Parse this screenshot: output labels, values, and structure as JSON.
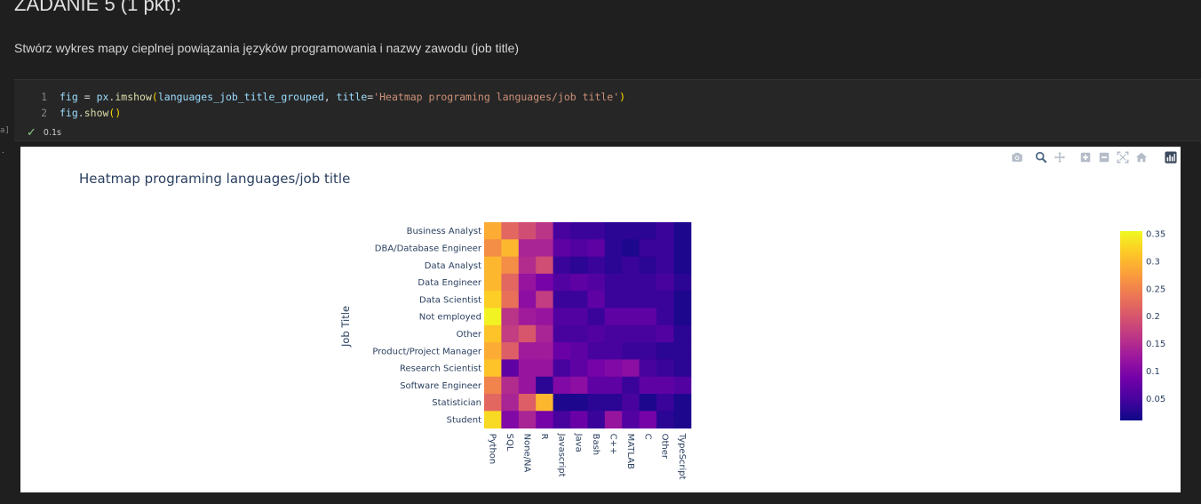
{
  "markdown": {
    "heading": "ZADANIE 5 (1 pkt):",
    "instruction": "Stwórz wykres mapy cieplnej powiązania języków programowania i nazwy zawodu (job title)"
  },
  "cell": {
    "execution_count": "a]",
    "line_numbers": [
      "1",
      "2"
    ],
    "line1": {
      "var": "fig",
      "eq": " = ",
      "mod": "px",
      "dot": ".",
      "fn": "imshow",
      "open": "(",
      "arg": "languages_job_title_grouped",
      "comma": ", ",
      "kw": "title",
      "assign": "=",
      "str": "'Heatmap programing languages/job title'",
      "close": ")"
    },
    "line2": {
      "var": "fig",
      "dot": ".",
      "fn": "show",
      "parens": "()"
    },
    "status_time": "0.1s",
    "output_marker": "."
  },
  "modebar_icons": [
    "camera-icon",
    "zoom-icon",
    "pan-icon",
    "zoom-in-icon",
    "zoom-out-icon",
    "autoscale-icon",
    "reset-axes-icon",
    "plotly-logo-icon"
  ],
  "chart_data": {
    "type": "heatmap",
    "title": "Heatmap programing languages/job title",
    "ylabel": "Job Title",
    "xlabel": "",
    "x": [
      "Python",
      "SQL",
      "None/NA",
      "R",
      "Javascript",
      "Java",
      "Bash",
      "C++",
      "MATLAB",
      "C",
      "Other",
      "TypeScript"
    ],
    "y": [
      "Business Analyst",
      "DBA/Database Engineer",
      "Data Analyst",
      "Data Engineer",
      "Data Scientist",
      "Not employed",
      "Other",
      "Product/Project Manager",
      "Research Scientist",
      "Software Engineer",
      "Statistician",
      "Student"
    ],
    "z": [
      [
        0.29,
        0.22,
        0.19,
        0.16,
        0.05,
        0.04,
        0.04,
        0.03,
        0.03,
        0.03,
        0.04,
        0.02
      ],
      [
        0.26,
        0.3,
        0.14,
        0.14,
        0.07,
        0.06,
        0.07,
        0.03,
        0.02,
        0.04,
        0.04,
        0.02
      ],
      [
        0.3,
        0.26,
        0.15,
        0.19,
        0.04,
        0.03,
        0.04,
        0.03,
        0.04,
        0.03,
        0.04,
        0.02
      ],
      [
        0.3,
        0.22,
        0.12,
        0.09,
        0.06,
        0.07,
        0.06,
        0.04,
        0.04,
        0.04,
        0.05,
        0.03
      ],
      [
        0.32,
        0.23,
        0.11,
        0.17,
        0.04,
        0.04,
        0.07,
        0.04,
        0.04,
        0.04,
        0.04,
        0.02
      ],
      [
        0.35,
        0.16,
        0.13,
        0.12,
        0.06,
        0.06,
        0.04,
        0.07,
        0.07,
        0.07,
        0.04,
        0.02
      ],
      [
        0.31,
        0.17,
        0.2,
        0.14,
        0.05,
        0.05,
        0.06,
        0.05,
        0.05,
        0.05,
        0.06,
        0.03
      ],
      [
        0.29,
        0.21,
        0.13,
        0.13,
        0.08,
        0.07,
        0.05,
        0.05,
        0.04,
        0.04,
        0.03,
        0.03
      ],
      [
        0.31,
        0.07,
        0.12,
        0.12,
        0.05,
        0.07,
        0.09,
        0.1,
        0.11,
        0.05,
        0.04,
        0.03
      ],
      [
        0.25,
        0.15,
        0.12,
        0.03,
        0.1,
        0.11,
        0.07,
        0.07,
        0.04,
        0.07,
        0.07,
        0.06
      ],
      [
        0.22,
        0.14,
        0.21,
        0.3,
        0.02,
        0.02,
        0.03,
        0.03,
        0.05,
        0.02,
        0.04,
        0.02
      ],
      [
        0.33,
        0.1,
        0.14,
        0.09,
        0.05,
        0.08,
        0.04,
        0.12,
        0.06,
        0.09,
        0.03,
        0.02
      ]
    ],
    "colorscale": [
      "#0d0887",
      "#46039f",
      "#7201a8",
      "#9c179e",
      "#bd3786",
      "#d8576b",
      "#ed7953",
      "#fb9f3a",
      "#fdca26",
      "#f0f921"
    ],
    "zmin": 0.01,
    "zmax": 0.355,
    "colorbar_ticks": [
      "0.05",
      "0.1",
      "0.15",
      "0.2",
      "0.25",
      "0.3",
      "0.35"
    ],
    "colorbar_tick_values": [
      0.05,
      0.1,
      0.15,
      0.2,
      0.25,
      0.3,
      0.35
    ]
  }
}
